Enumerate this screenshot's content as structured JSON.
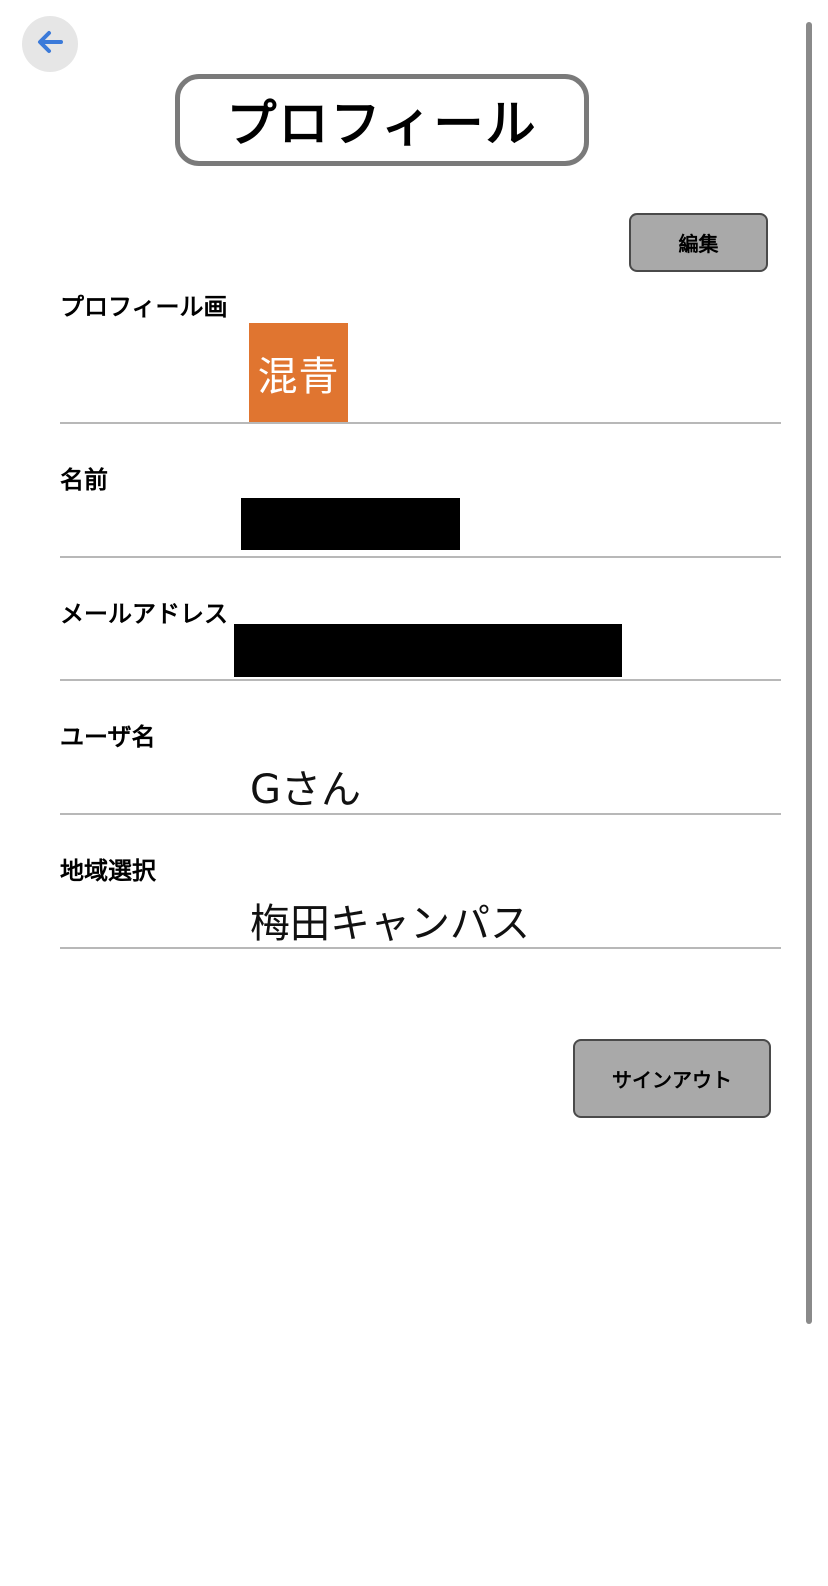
{
  "header": {
    "back_icon": "arrow-left-icon",
    "back_icon_color": "#3b7ad9",
    "title": "プロフィール"
  },
  "actions": {
    "edit_label": "編集",
    "signout_label": "サインアウト"
  },
  "profile": {
    "image_label": "プロフィール画",
    "avatar_text": "混青",
    "avatar_color": "#e07530",
    "name_label": "名前",
    "email_label": "メールアドレス",
    "username_label": "ユーザ名",
    "username_value": "Gさん",
    "region_label": "地域選択",
    "region_value": "梅田キャンパス"
  }
}
